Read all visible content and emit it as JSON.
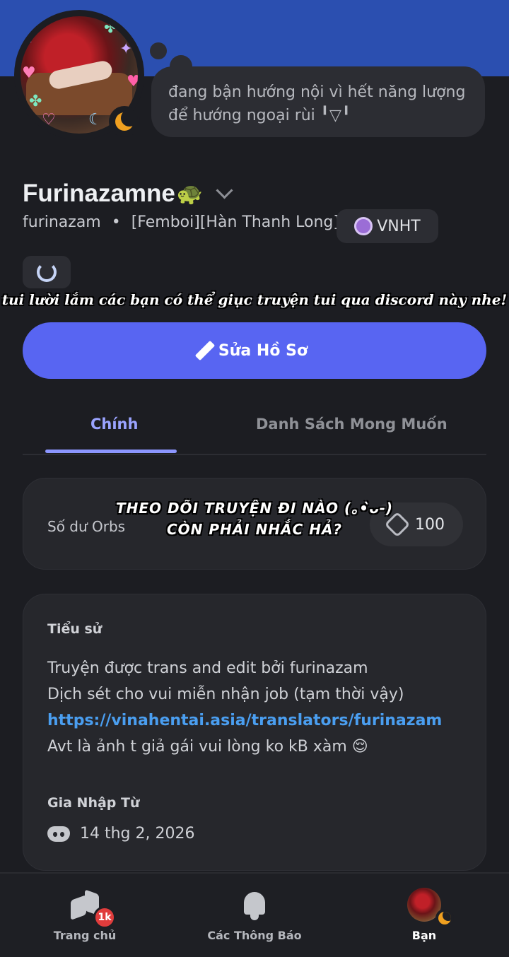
{
  "profile": {
    "status_line1": "đang bận hướng nội vì hết năng lượng",
    "status_line2": "để hướng ngoại rùi ╹▽╹",
    "display_name": "Furinazamne",
    "display_emoji": "🐢",
    "username": "furinazam",
    "separator": "•",
    "pronouns": "[Femboi][Hàn Thanh Long]",
    "server_tag": "VNHT"
  },
  "captions": {
    "top": "tui lười lắm các bạn có thể giục truyện tui qua discord này nhe!",
    "middle_line1": "THEO DÕI TRUYỆN ĐI NÀO (｡•̀ᴗ-)",
    "middle_line2": "CÒN PHẢI NHẮC HẢ?"
  },
  "actions": {
    "edit_profile": "Sửa Hồ Sơ"
  },
  "tabs": [
    {
      "label": "Chính",
      "active": true
    },
    {
      "label": "Danh Sách Mong Muốn",
      "active": false
    }
  ],
  "orbs": {
    "label": "Số dư Orbs",
    "balance": "100"
  },
  "bio": {
    "label": "Tiểu sử",
    "line1": "Truyện được trans and edit bởi furinazam",
    "line2": "Dịch sét cho vui miễn nhận job (tạm thời vậy)",
    "link": "https://vinahentai.asia/translators/furinazam",
    "line4": "Avt là ảnh t giả gái vui lòng ko kB xàm 😌"
  },
  "joined": {
    "label": "Gia Nhập Từ",
    "date": "14 thg 2, 2026"
  },
  "nav": {
    "home": "Trang chủ",
    "home_badge": "1k",
    "notifications": "Các Thông Báo",
    "you": "Bạn"
  },
  "colors": {
    "accent": "#5865f2",
    "banner": "#2b4fb0",
    "link": "#4a9ef0",
    "badge": "#e03c3c"
  }
}
